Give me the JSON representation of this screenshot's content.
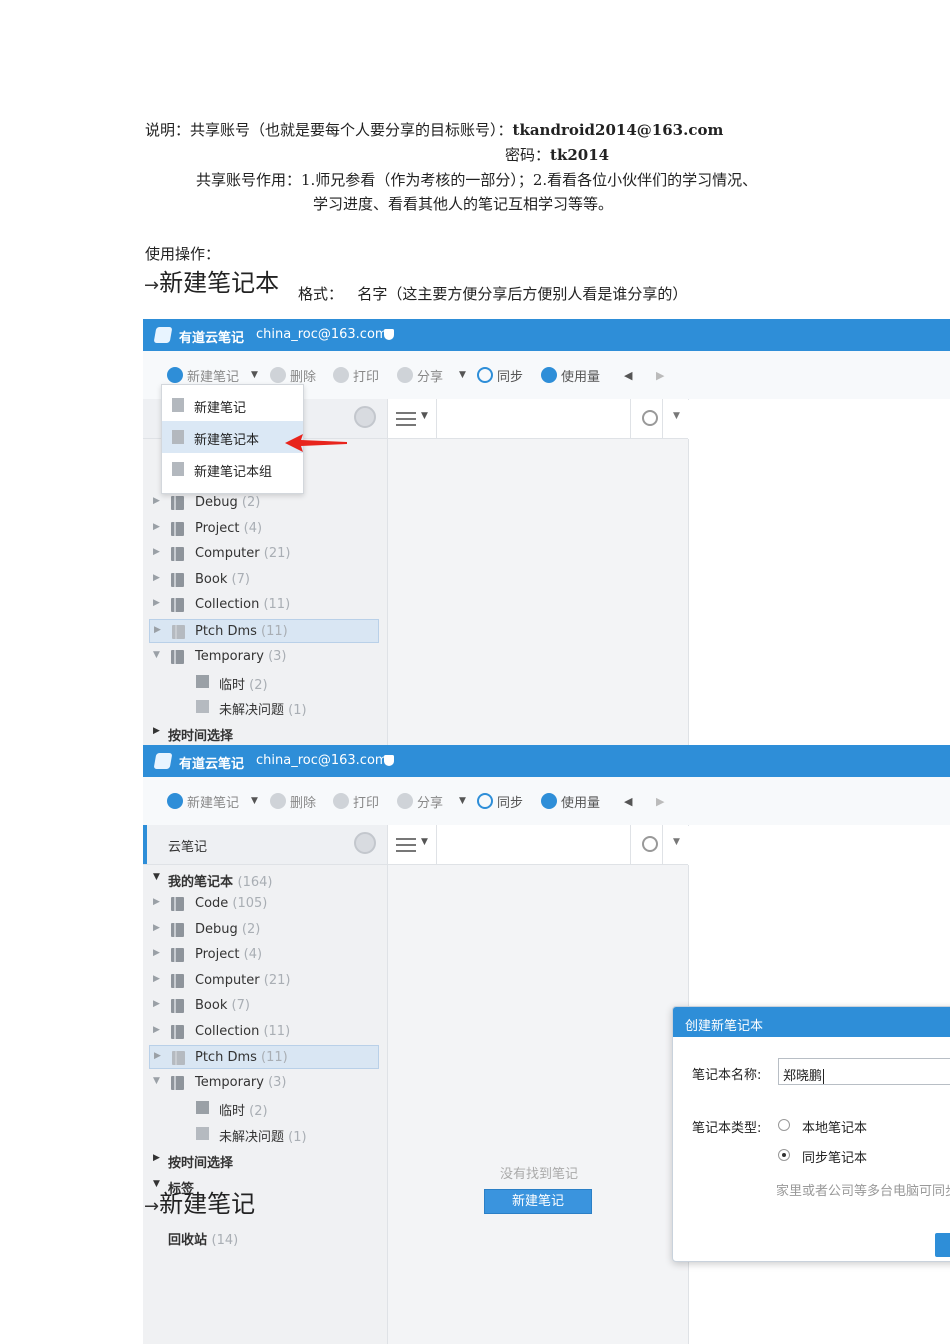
{
  "intro": {
    "line1_prefix": "说明：共享账号（也就是要每个人要分享的目标账号）：",
    "line1_account": "tkandroid2014@163.com",
    "line2_prefix": "密码：",
    "line2_password": "tk2014",
    "line3": "共享账号作用：1.师兄参看（作为考核的一部分）；2.看看各位小伙伴们的学习情况、",
    "line4": "学习进度、看看其他人的笔记互相学习等等。",
    "usage": "使用操作："
  },
  "step1": {
    "arrow": "→",
    "heading": "新建笔记本",
    "format_label": "格式：",
    "format_desc": "名字（这主要方便分享后方便别人看是谁分享的）"
  },
  "step2": {
    "arrow": "→",
    "heading": "新建笔记"
  },
  "app": {
    "title": "有道云笔记",
    "account": "china_roc@163.com",
    "brand_color": "#2e8ed8",
    "toolbar": {
      "new_note": "新建笔记",
      "delete": "删除",
      "print": "打印",
      "share": "分享",
      "sync": "同步",
      "usage": "使用量",
      "prev_icon": "triangle-left-icon",
      "next_icon": "triangle-right-icon"
    },
    "sidebar_head": "云笔记",
    "my_notebooks": "我的笔记本",
    "my_notebooks_count": "(164)",
    "notebooks": [
      {
        "name": "Code",
        "count": "(105)"
      },
      {
        "name": "Debug",
        "count": "(2)"
      },
      {
        "name": "Project",
        "count": "(4)"
      },
      {
        "name": "Computer",
        "count": "(21)"
      },
      {
        "name": "Book",
        "count": "(7)"
      },
      {
        "name": "Collection",
        "count": "(11)"
      },
      {
        "name": "Ptch Dms",
        "count": "(11)"
      },
      {
        "name": "Temporary",
        "count": "(3)"
      }
    ],
    "sub_notebooks": [
      {
        "name": "临时",
        "count": "(2)"
      },
      {
        "name": "未解决问题",
        "count": "(1)"
      }
    ],
    "by_time": "按时间选择",
    "tags": "标签",
    "recycle": "回收站",
    "recycle_count": "(14)",
    "empty_text": "没有找到笔记",
    "new_note_button": "新建笔记",
    "dropdown": [
      "新建笔记",
      "新建笔记本",
      "新建笔记本组"
    ],
    "dialog": {
      "title": "创建新笔记本",
      "name_label": "笔记本名称:",
      "name_value": "郑晓鹏",
      "type_label": "笔记本类型:",
      "option_local": "本地笔记本",
      "option_sync": "同步笔记本",
      "hint": "家里或者公司等多台电脑可同步"
    }
  }
}
